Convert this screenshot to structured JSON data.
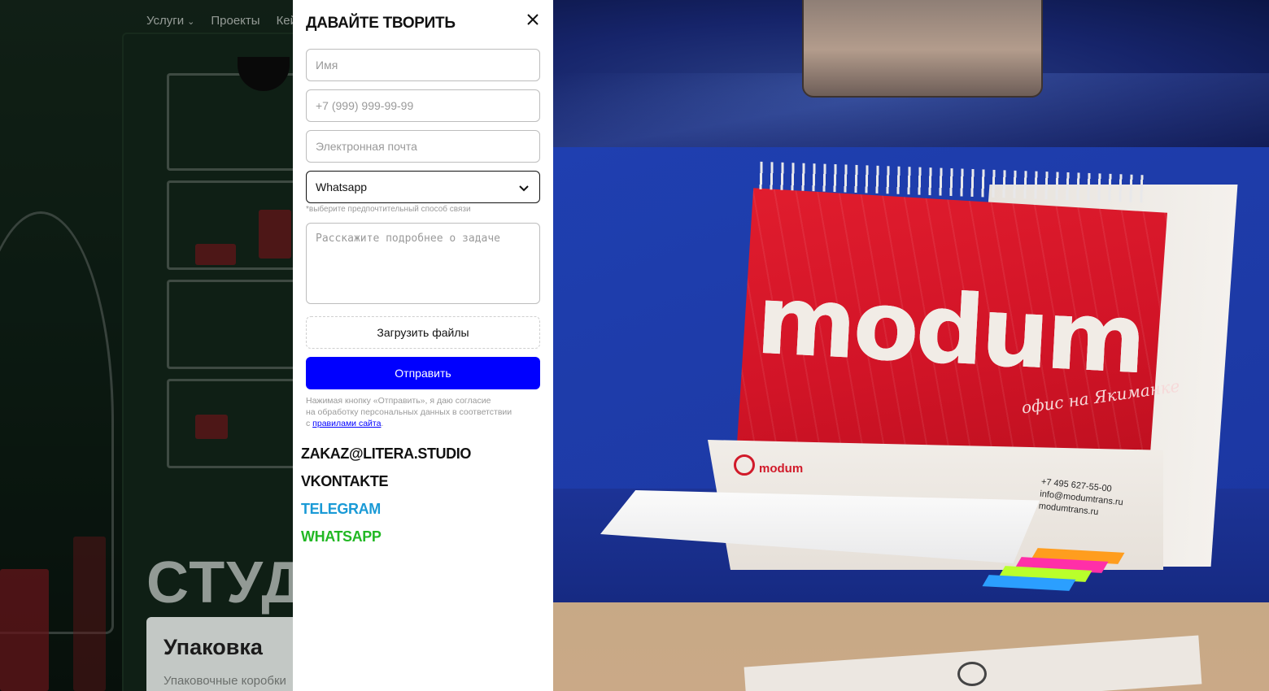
{
  "background_page": {
    "nav": {
      "services": "Услуги",
      "projects": "Проекты",
      "cases_partial": "Кей"
    },
    "hero_title_partial": "СТУДИ",
    "card": {
      "title": "Упаковка",
      "subtitle": "Упаковочные коробки"
    }
  },
  "modal": {
    "title": "ДАВАЙТЕ ТВОРИТЬ",
    "fields": {
      "name_placeholder": "Имя",
      "phone_placeholder": "+7 (999) 999-99-99",
      "email_placeholder": "Электронная почта",
      "contact_method_selected": "Whatsapp",
      "contact_method_hint": "*выберите предпочтительный способ связи",
      "task_placeholder": "Расскажите подробнее о задаче"
    },
    "upload_label": "Загрузить файлы",
    "submit_label": "Отправить",
    "consent": {
      "line1": "Нажимая кнопку «Отправить», я даю согласие",
      "line2": "на обработку персональных данных в соответствии",
      "line3_prefix": "с ",
      "link_text": "правилами сайта",
      "line3_suffix": "."
    },
    "contacts": [
      {
        "label": "ZAKAZ@LITERA.STUDIO",
        "color": "#111111"
      },
      {
        "label": "VKONTAKTE",
        "color": "#111111"
      },
      {
        "label": "TELEGRAM",
        "color": "#1a9ad6"
      },
      {
        "label": "WHATSAPP",
        "color": "#22b824"
      }
    ]
  },
  "gallery": {
    "calendar_brand": "modum",
    "calendar_script": "офис на Якиманке",
    "calendar_contacts": [
      "+7 495 627-55-00",
      "info@modumtrans.ru",
      "modumtrans.ru"
    ]
  },
  "colors": {
    "accent_blue": "#0000ff",
    "telegram": "#1a9ad6",
    "whatsapp": "#22b824"
  }
}
